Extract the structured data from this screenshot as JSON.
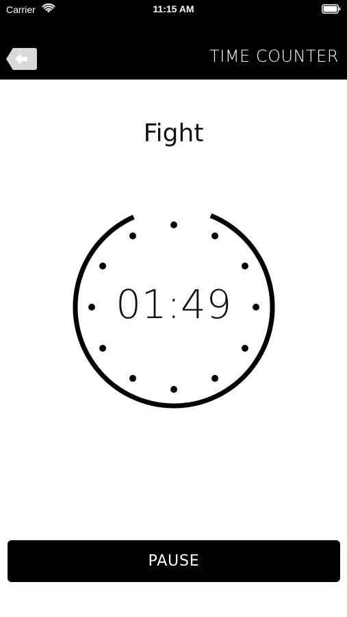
{
  "status_bar": {
    "carrier": "Carrier",
    "time": "11:15 AM"
  },
  "nav": {
    "title": "TIME COUNTER",
    "back_icon": "back-arrow-icon"
  },
  "timer": {
    "phase": "Fight",
    "remaining": "01:49",
    "progress_remaining_fraction": 0.93
  },
  "actions": {
    "pause_label": "PAUSE"
  },
  "colors": {
    "bar": "#000000",
    "background": "#ffffff",
    "text": "#111111",
    "back_button_bg": "#d9d9d9"
  }
}
